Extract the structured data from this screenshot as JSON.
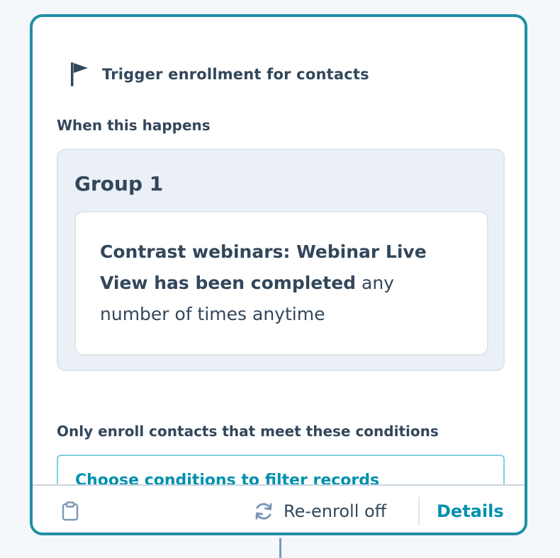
{
  "trigger": {
    "title": "Trigger enrollment for contacts",
    "icon": "flag-icon"
  },
  "when_label": "When this happens",
  "group": {
    "title": "Group 1",
    "condition": {
      "strong": "Contrast webinars: Webinar Live View has been completed",
      "rest": " any number of times anytime"
    }
  },
  "only_label": "Only enroll contacts that meet these conditions",
  "filter": {
    "link_label": "Choose conditions to filter records"
  },
  "footer": {
    "clipboard_icon": "clipboard-icon",
    "refresh_icon": "refresh-icon",
    "reenroll_label": "Re-enroll off",
    "details_label": "Details"
  },
  "colors": {
    "accent": "#1f8fa5",
    "link": "#0091ae",
    "text": "#33475b",
    "group_bg": "#eaf0f6"
  }
}
